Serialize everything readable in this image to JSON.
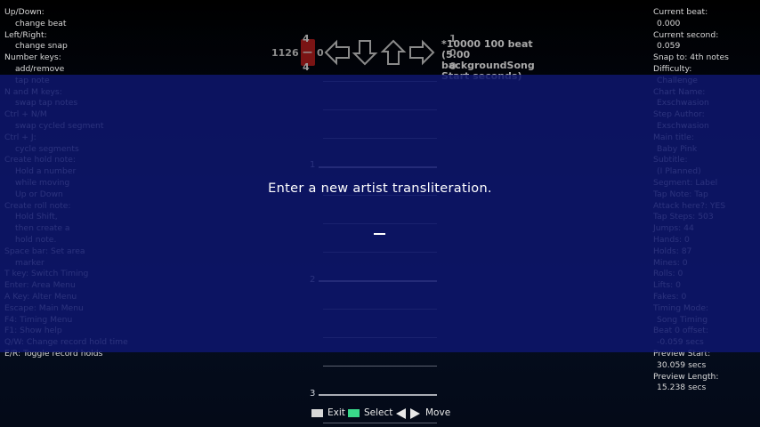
{
  "left_help": [
    {
      "text": "Up/Down:",
      "indent": 0
    },
    {
      "text": "change beat",
      "indent": 1
    },
    {
      "text": "Left/Right:",
      "indent": 0
    },
    {
      "text": "change snap",
      "indent": 1
    },
    {
      "text": "Number keys:",
      "indent": 0
    },
    {
      "text": "add/remove",
      "indent": 1
    },
    {
      "text": "tap note",
      "indent": 1
    },
    {
      "text": "N and M keys:",
      "indent": 0
    },
    {
      "text": "swap tap notes",
      "indent": 1
    },
    {
      "text": "Ctrl + N/M",
      "indent": 0
    },
    {
      "text": "swap cycled segment",
      "indent": 1
    },
    {
      "text": "Ctrl + J:",
      "indent": 0
    },
    {
      "text": "cycle segments",
      "indent": 1
    },
    {
      "text": "Create hold note:",
      "indent": 0
    },
    {
      "text": "Hold a number",
      "indent": 1
    },
    {
      "text": "while moving",
      "indent": 1
    },
    {
      "text": "Up or Down",
      "indent": 1
    },
    {
      "text": "Create roll note:",
      "indent": 0
    },
    {
      "text": "Hold Shift,",
      "indent": 1
    },
    {
      "text": "then create a",
      "indent": 1
    },
    {
      "text": "hold note.",
      "indent": 1
    },
    {
      "text": "Space bar: Set area",
      "indent": 0
    },
    {
      "text": "marker",
      "indent": 1
    },
    {
      "text": "T key: Switch Timing",
      "indent": 0
    },
    {
      "text": "Enter: Area Menu",
      "indent": 0
    },
    {
      "text": "A Key: Alter Menu",
      "indent": 0
    },
    {
      "text": "Escape: Main Menu",
      "indent": 0
    },
    {
      "text": "F4: Timing Menu",
      "indent": 0
    },
    {
      "text": "F1: Show help",
      "indent": 0
    },
    {
      "text": "Q/W: Change record hold time",
      "indent": 0
    },
    {
      "text": "E/R: Toggle record holds",
      "indent": 0
    }
  ],
  "right_info": [
    {
      "text": "Current beat:",
      "indent": 0
    },
    {
      "text": "0.000",
      "indent": 1
    },
    {
      "text": "Current second:",
      "indent": 0
    },
    {
      "text": "0.059",
      "indent": 1
    },
    {
      "text": "Snap to: 4th notes",
      "indent": 0
    },
    {
      "text": "Difficulty:",
      "indent": 0
    },
    {
      "text": "Challenge",
      "indent": 1
    },
    {
      "text": "Chart Name:",
      "indent": 0
    },
    {
      "text": "Exschwasion",
      "indent": 1
    },
    {
      "text": "Step Author:",
      "indent": 0
    },
    {
      "text": "Exschwasion",
      "indent": 1
    },
    {
      "text": "Main title:",
      "indent": 0
    },
    {
      "text": "Baby Pink",
      "indent": 1
    },
    {
      "text": "Subtitle:",
      "indent": 0
    },
    {
      "text": "(I Planned)",
      "indent": 1
    },
    {
      "text": "Segment: Label",
      "indent": 0
    },
    {
      "text": "Tap Note: Tap",
      "indent": 0
    },
    {
      "text": "Attack here?: YES",
      "indent": 0
    },
    {
      "text": "Tap Steps: 503",
      "indent": 0
    },
    {
      "text": "Jumps: 44",
      "indent": 0
    },
    {
      "text": "Hands: 0",
      "indent": 0
    },
    {
      "text": "Holds: 87",
      "indent": 0
    },
    {
      "text": "Mines: 0",
      "indent": 0
    },
    {
      "text": "Rolls: 0",
      "indent": 0
    },
    {
      "text": "Lifts: 0",
      "indent": 0
    },
    {
      "text": "Fakes: 0",
      "indent": 0
    },
    {
      "text": "Timing Mode:",
      "indent": 0
    },
    {
      "text": "Song Timing",
      "indent": 1
    },
    {
      "text": "Beat 0 offset:",
      "indent": 0
    },
    {
      "text": "-0.059 secs",
      "indent": 1
    },
    {
      "text": "Preview Start:",
      "indent": 0
    },
    {
      "text": "30.059 secs",
      "indent": 1
    },
    {
      "text": "Preview Length:",
      "indent": 0
    },
    {
      "text": "15.238 secs",
      "indent": 1
    }
  ],
  "notefield": {
    "header_left_number": "1126",
    "header_zero": "0",
    "red_top": "4",
    "red_bottom": "4",
    "red_mid": "—",
    "right_top": "1",
    "right_mid": "0",
    "right_bottom": "0",
    "bg_change_label": "*10000 100 beat (5.00 backgroundSong Start seconds)",
    "beat_numbers": [
      "1",
      "2",
      "3"
    ],
    "arrows": [
      "left",
      "down",
      "up",
      "right"
    ]
  },
  "modal": {
    "prompt": "Enter a new artist transliteration.",
    "input_value": ""
  },
  "footer": {
    "exit_label": "Exit",
    "select_label": "Select",
    "move_label": "Move"
  },
  "colors": {
    "overlay": "#0e166e",
    "select_key": "#39d98a",
    "exit_key": "#d8d8d8",
    "hold_bar": "#7a1414"
  }
}
